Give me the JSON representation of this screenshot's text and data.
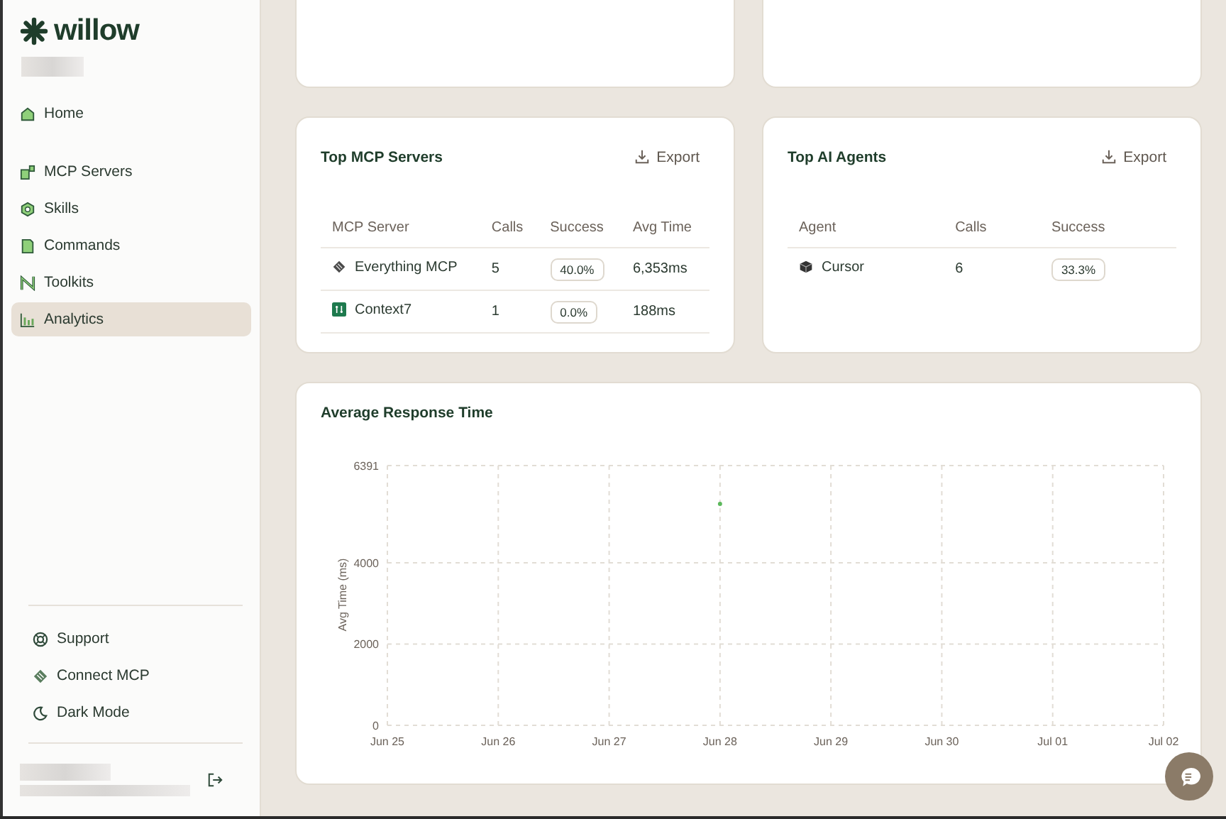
{
  "brand": {
    "name": "willow"
  },
  "nav_top": [
    {
      "label": "Home",
      "selected": false
    }
  ],
  "nav_items": [
    {
      "label": "MCP Servers",
      "selected": false
    },
    {
      "label": "Skills",
      "selected": false
    },
    {
      "label": "Commands",
      "selected": false
    },
    {
      "label": "Toolkits",
      "selected": false
    },
    {
      "label": "Analytics",
      "selected": true
    }
  ],
  "footer_links": [
    {
      "label": "Support"
    },
    {
      "label": "Connect MCP"
    },
    {
      "label": "Dark Mode"
    }
  ],
  "servers": {
    "title": "Top MCP Servers",
    "export": "Export",
    "columns": [
      "MCP Server",
      "Calls",
      "Success",
      "Avg Time"
    ],
    "rows": [
      {
        "name": "Everything MCP",
        "calls": "5",
        "success": "40.0%",
        "avg_time": "6,353ms"
      },
      {
        "name": "Context7",
        "calls": "1",
        "success": "0.0%",
        "avg_time": "188ms"
      }
    ]
  },
  "agents": {
    "title": "Top AI Agents",
    "export": "Export",
    "columns": [
      "Agent",
      "Calls",
      "Success"
    ],
    "rows": [
      {
        "name": "Cursor",
        "calls": "6",
        "success": "33.3%"
      }
    ]
  },
  "response_chart": {
    "title": "Average Response Time",
    "chart_data": {
      "type": "line",
      "ylabel": "Avg Time (ms)",
      "categories": [
        "Jun 25",
        "Jun 26",
        "Jun 27",
        "Jun 28",
        "Jun 29",
        "Jun 30",
        "Jul 01",
        "Jul 02"
      ],
      "series": [
        {
          "color": "#5cb85c",
          "marker": true,
          "values": [
            null,
            null,
            null,
            5450,
            null,
            null,
            null,
            null
          ]
        }
      ],
      "ylim": [
        0,
        6391
      ],
      "yticks": [
        0,
        2000,
        4000,
        6391
      ],
      "grid": true
    }
  }
}
